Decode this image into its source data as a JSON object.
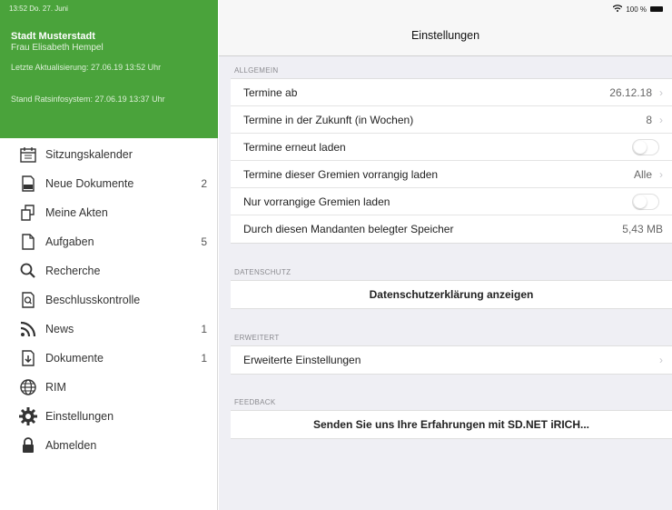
{
  "statusbar": {
    "time_date": "13:52  Do. 27. Juni",
    "wifi_battery": "100 %"
  },
  "header": {
    "city": "Stadt Musterstadt",
    "user": "Frau Elisabeth Hempel",
    "last_update": "Letzte Aktualisierung: 27.06.19 13:52 Uhr",
    "stand": "Stand Ratsinfosystem: 27.06.19 13:37 Uhr"
  },
  "sidebar": {
    "items": [
      {
        "label": "Sitzungskalender",
        "count": "",
        "icon": "calendar-icon"
      },
      {
        "label": "Neue Dokumente",
        "count": "2",
        "icon": "new-document-icon"
      },
      {
        "label": "Meine Akten",
        "count": "",
        "icon": "folders-icon"
      },
      {
        "label": "Aufgaben",
        "count": "5",
        "icon": "task-icon"
      },
      {
        "label": "Recherche",
        "count": "",
        "icon": "search-icon"
      },
      {
        "label": "Beschlusskontrolle",
        "count": "",
        "icon": "resolution-check-icon"
      },
      {
        "label": "News",
        "count": "1",
        "icon": "rss-icon"
      },
      {
        "label": "Dokumente",
        "count": "1",
        "icon": "download-document-icon"
      },
      {
        "label": "RIM",
        "count": "",
        "icon": "globe-icon"
      },
      {
        "label": "Einstellungen",
        "count": "",
        "icon": "gear-icon"
      },
      {
        "label": "Abmelden",
        "count": "",
        "icon": "lock-icon"
      }
    ]
  },
  "main": {
    "title": "Einstellungen",
    "sections": {
      "allgemein": {
        "label": "ALLGEMEIN",
        "rows": [
          {
            "label": "Termine ab",
            "value": "26.12.18"
          },
          {
            "label": "Termine in der Zukunft (in Wochen)",
            "value": "8"
          },
          {
            "label": "Termine erneut laden",
            "value": ""
          },
          {
            "label": "Termine dieser Gremien vorrangig laden",
            "value": "Alle"
          },
          {
            "label": "Nur vorrangige Gremien laden",
            "value": ""
          },
          {
            "label": "Durch diesen Mandanten belegter Speicher",
            "value": "5,43 MB"
          }
        ]
      },
      "datenschutz": {
        "label": "DATENSCHUTZ",
        "button": "Datenschutzerklärung anzeigen"
      },
      "erweitert": {
        "label": "ERWEITERT",
        "row": "Erweiterte Einstellungen"
      },
      "feedback": {
        "label": "FEEDBACK",
        "button": "Senden Sie uns Ihre Erfahrungen mit SD.NET iRICH..."
      }
    }
  },
  "colors": {
    "accent": "#4aa33b",
    "background": "#efeff4"
  }
}
